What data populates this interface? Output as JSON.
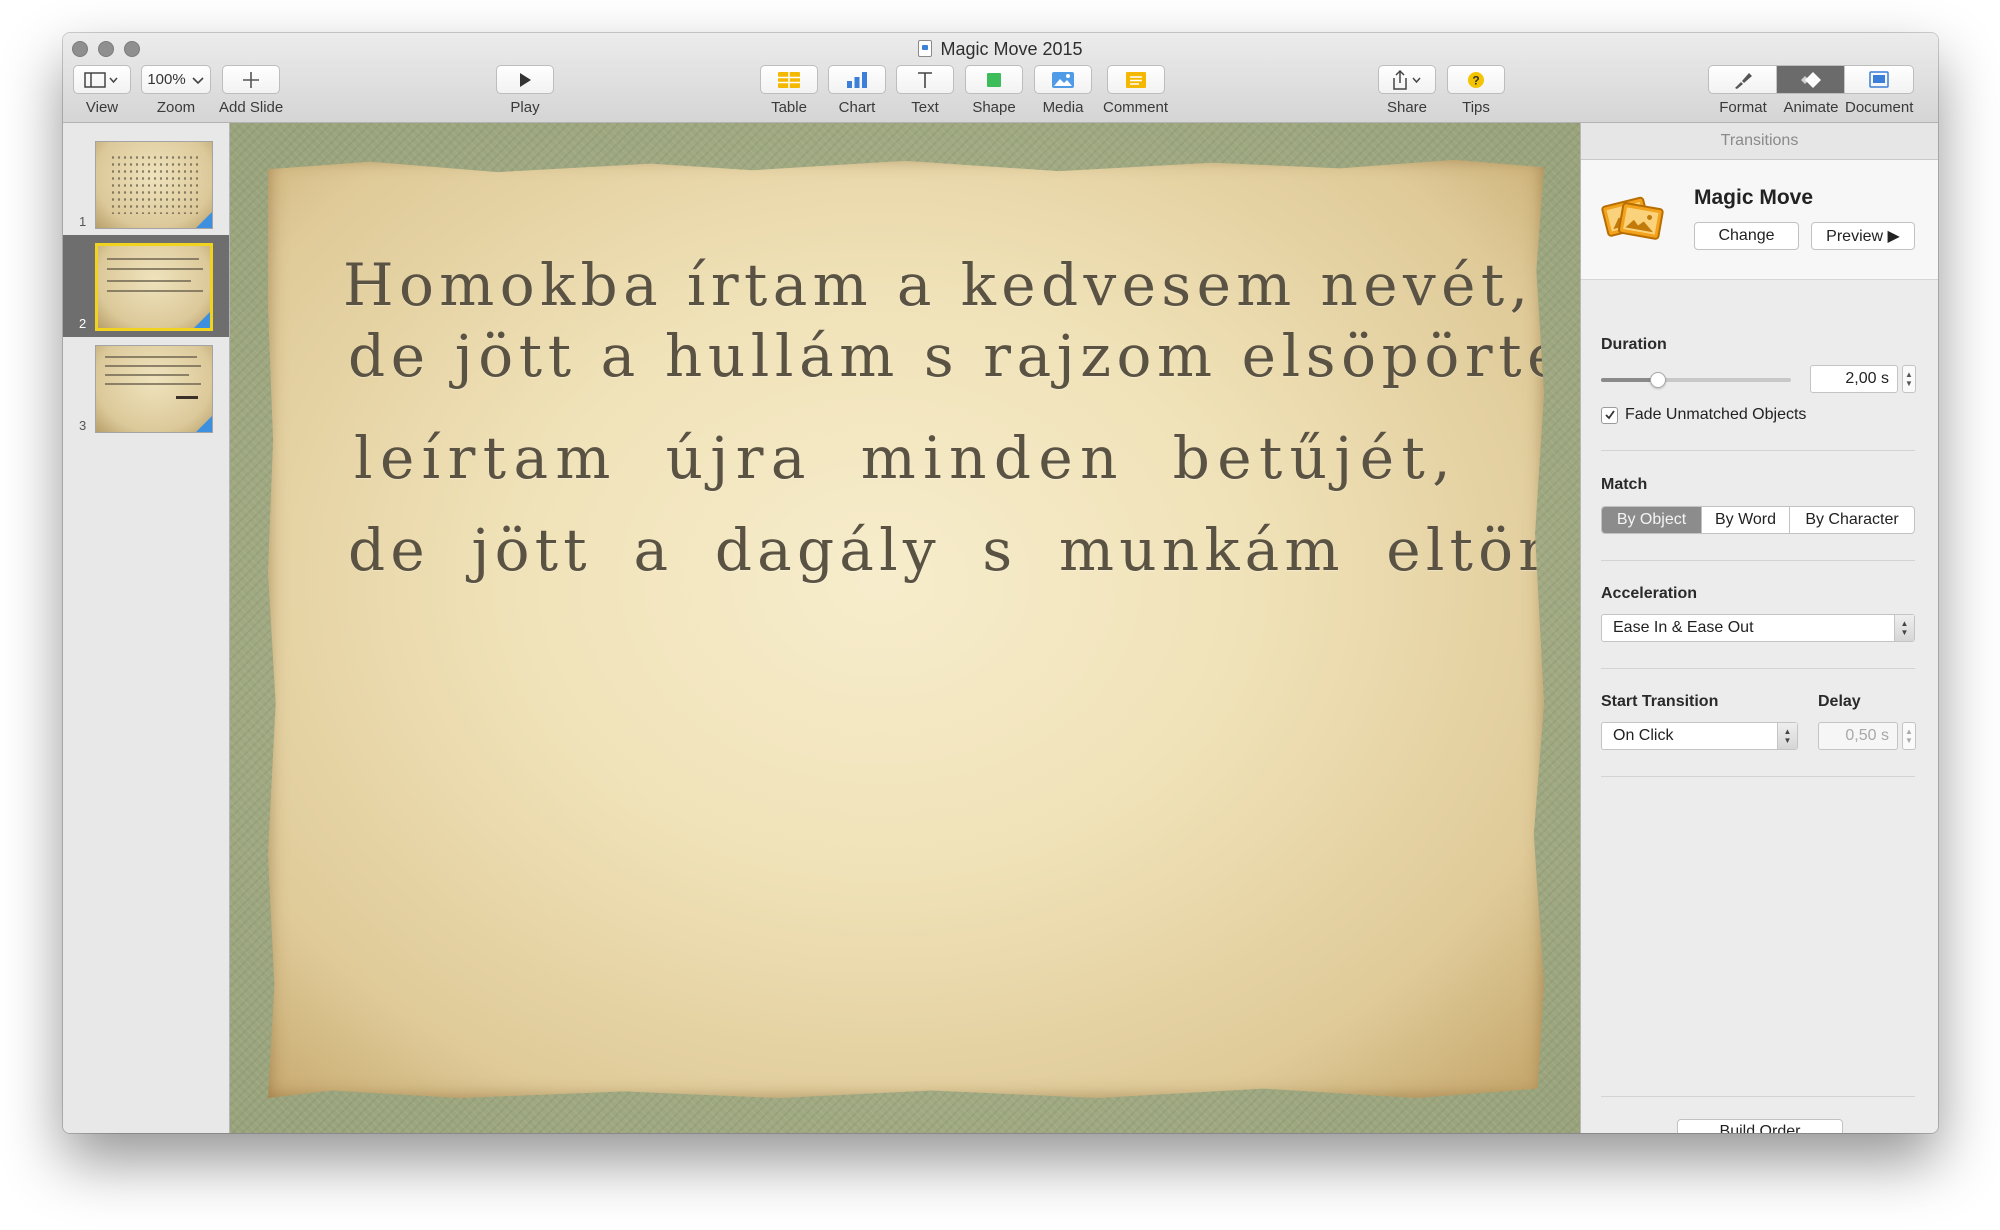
{
  "window": {
    "title": "Magic Move 2015"
  },
  "toolbar": {
    "view_label": "View",
    "zoom_value": "100%",
    "zoom_label": "Zoom",
    "add_slide_label": "Add Slide",
    "play_label": "Play",
    "table_label": "Table",
    "chart_label": "Chart",
    "text_label": "Text",
    "shape_label": "Shape",
    "media_label": "Media",
    "comment_label": "Comment",
    "share_label": "Share",
    "tips_label": "Tips",
    "format_label": "Format",
    "animate_label": "Animate",
    "document_label": "Document",
    "active_inspector": "Animate"
  },
  "navigator": {
    "slides": [
      {
        "number": "1",
        "selected": false
      },
      {
        "number": "2",
        "selected": true
      },
      {
        "number": "3",
        "selected": false
      }
    ]
  },
  "slide": {
    "lines": [
      "Homokba írtam a kedvesem nevét,",
      "de jött a hullám s rajzom elsöpörte:",
      "leírtam újra minden betűjét,",
      "de jött a dagály s munkám eltörölte."
    ]
  },
  "inspector": {
    "header": "Transitions",
    "transition_name": "Magic Move",
    "change_label": "Change",
    "preview_label": "Preview ▶",
    "duration_label": "Duration",
    "duration_value": "2,00 s",
    "duration_fraction": 0.28,
    "fade_label": "Fade Unmatched Objects",
    "fade_checked": true,
    "match_label": "Match",
    "match_options": [
      "By Object",
      "By Word",
      "By Character"
    ],
    "match_selected": "By Object",
    "acceleration_label": "Acceleration",
    "acceleration_value": "Ease In & Ease Out",
    "start_label": "Start Transition",
    "start_value": "On Click",
    "delay_label": "Delay",
    "delay_value": "0,50 s",
    "build_order_label": "Build Order"
  },
  "colors": {
    "accent_yellow": "#f0d21f",
    "thumb_corner_blue": "#3d8fe0",
    "canvas_green": "#a4ad84",
    "poem_text": "#5a5242"
  }
}
